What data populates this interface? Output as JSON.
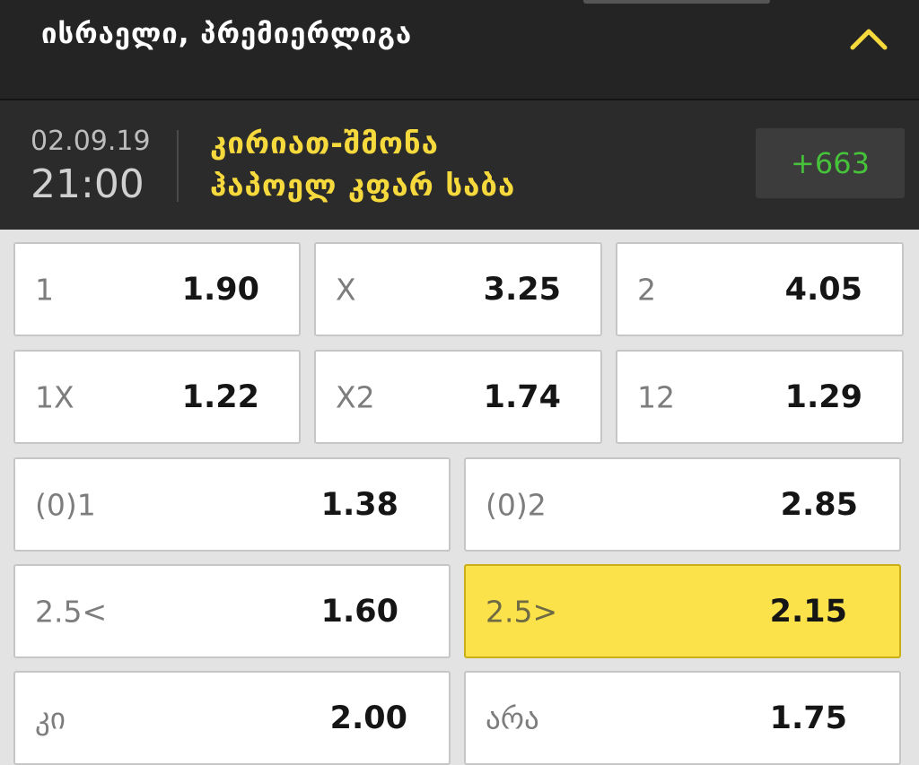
{
  "header": {
    "league_title": "ისრაელი, პრემიერლიგა",
    "collapse_icon": "chevron-up-icon",
    "accent_color": "#f6d93c"
  },
  "match": {
    "date": "02.09.19",
    "time": "21:00",
    "home_team": "კირიათ-შმონა",
    "away_team": "ჰაპოელ კფარ საბა",
    "more_markets": "+663"
  },
  "odds": {
    "row1": [
      {
        "label": "1",
        "value": "1.90"
      },
      {
        "label": "X",
        "value": "3.25"
      },
      {
        "label": "2",
        "value": "4.05"
      }
    ],
    "row2": [
      {
        "label": "1X",
        "value": "1.22"
      },
      {
        "label": "X2",
        "value": "1.74"
      },
      {
        "label": "12",
        "value": "1.29"
      }
    ],
    "row3": [
      {
        "label": "(0)1",
        "value": "1.38"
      },
      {
        "label": "(0)2",
        "value": "2.85"
      }
    ],
    "row4": [
      {
        "label": "2.5<",
        "value": "1.60"
      },
      {
        "label": "2.5>",
        "value": "2.15",
        "selected": true
      }
    ],
    "row5": [
      {
        "label": "კი",
        "value": "2.00"
      },
      {
        "label": "არა",
        "value": "1.75"
      }
    ]
  }
}
